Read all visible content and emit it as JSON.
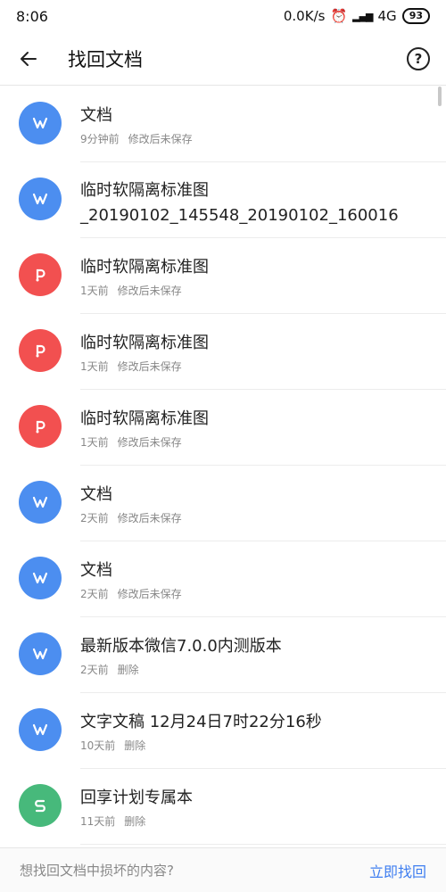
{
  "status_bar": {
    "time": "8:06",
    "net_speed": "0.0K/s",
    "network": "4G",
    "battery": "93"
  },
  "header": {
    "title": "找回文档",
    "help_label": "?"
  },
  "documents": [
    {
      "name": "文档",
      "time": "9分钟前",
      "status": "修改后未保存",
      "type": "word"
    },
    {
      "name": "临时软隔离标准图\n_20190102_145548_20190102_160016",
      "time": "",
      "status": "",
      "type": "word"
    },
    {
      "name": "临时软隔离标准图",
      "time": "1天前",
      "status": "修改后未保存",
      "type": "ppt"
    },
    {
      "name": "临时软隔离标准图",
      "time": "1天前",
      "status": "修改后未保存",
      "type": "ppt"
    },
    {
      "name": "临时软隔离标准图",
      "time": "1天前",
      "status": "修改后未保存",
      "type": "ppt"
    },
    {
      "name": "文档",
      "time": "2天前",
      "status": "修改后未保存",
      "type": "word"
    },
    {
      "name": "文档",
      "time": "2天前",
      "status": "修改后未保存",
      "type": "word"
    },
    {
      "name": "最新版本微信7.0.0内测版本",
      "time": "2天前",
      "status": "删除",
      "type": "word"
    },
    {
      "name": "文字文稿 12月24日7时22分16秒",
      "time": "10天前",
      "status": "删除",
      "type": "word"
    },
    {
      "name": "回享计划专属本",
      "time": "11天前",
      "status": "删除",
      "type": "sheet"
    }
  ],
  "bottom": {
    "question": "想找回文档中损坏的内容?",
    "action": "立即找回"
  },
  "colors": {
    "word": "#4c8ef0",
    "ppt": "#f25050",
    "sheet": "#47b97b",
    "link": "#3f7ef0"
  }
}
